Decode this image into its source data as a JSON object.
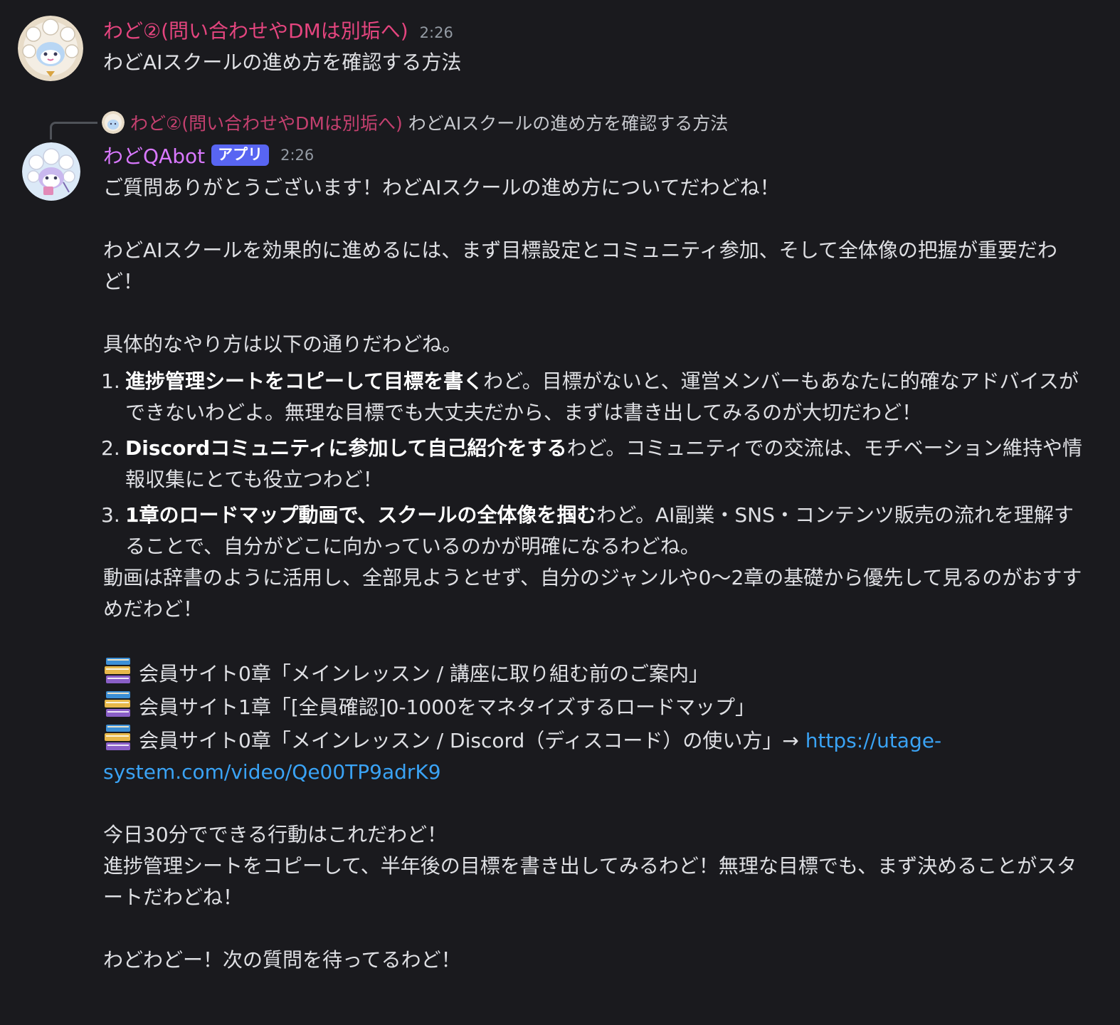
{
  "colors": {
    "background": "#1a1a1e",
    "text": "#dfe0e4",
    "user_name": "#e5457f",
    "bot_name": "#d978ff",
    "app_badge": "#5865f2",
    "link": "#3aa3f5",
    "timestamp": "#949ba4"
  },
  "message1": {
    "avatar_icon": "sheep-mascot-avatar-icon",
    "author": "わど②(問い合わせやDMは別垢へ)",
    "timestamp": "2:26",
    "text": "わどAIスクールの進め方を確認する方法"
  },
  "reply_preview": {
    "avatar_icon": "sheep-mascot-mini-avatar-icon",
    "author": "わど②(問い合わせやDMは別垢へ)",
    "text": "わどAIスクールの進め方を確認する方法"
  },
  "message2": {
    "avatar_icon": "sheep-bot-avatar-icon",
    "author": "わどQAbot",
    "badge": "アプリ",
    "timestamp": "2:26",
    "greeting": "ご質問ありがとうございます！わどAIスクールの進め方についてだわどね！",
    "intro": "わどAIスクールを効果的に進めるには、まず目標設定とコミュニティ参加、そして全体像の把握が重要だわど！",
    "lead": "具体的なやり方は以下の通りだわどね。",
    "steps": [
      {
        "num": "1.",
        "bold": "進捗管理シートをコピーして目標を書く",
        "text": "わど。目標がないと、運営メンバーもあなたに的確なアドバイスができないわどよ。無理な目標でも大丈夫だから、まずは書き出してみるのが大切だわど！"
      },
      {
        "num": "2.",
        "bold": "Discordコミュニティに参加して自己紹介をする",
        "text": "わど。コミュニティでの交流は、モチベーション維持や情報収集にとても役立つわど！"
      },
      {
        "num": "3.",
        "bold": "1章のロードマップ動画で、スクールの全体像を掴む",
        "text": "わど。AI副業・SNS・コンテンツ販売の流れを理解することで、自分がどこに向かっているのかが明確になるわどね。"
      }
    ],
    "advice": "動画は辞書のように活用し、全部見ようとせず、自分のジャンルや0〜2章の基礎から優先して見るのがおすすめだわど！",
    "references": [
      {
        "icon": "books-icon",
        "text": "会員サイト0章「メインレッスン / 講座に取り組む前のご案内」"
      },
      {
        "icon": "books-icon",
        "text": "会員サイト1章「[全員確認]0-1000をマネタイズするロードマップ」"
      },
      {
        "icon": "books-icon",
        "text": "会員サイト0章「メインレッスン / Discord（ディスコード）の使い方」→ ",
        "link_part1": "https://utage-",
        "link_part2": "system.com/video/Qe00TP9adrK9"
      }
    ],
    "action_title": "今日30分でできる行動はこれだわど！",
    "action_text": "進捗管理シートをコピーして、半年後の目標を書き出してみるわど！無理な目標でも、まず決めることがスタートだわどね！",
    "closing": "わどわどー！次の質問を待ってるわど！"
  }
}
